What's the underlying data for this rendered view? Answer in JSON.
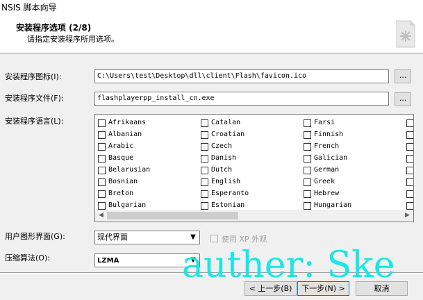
{
  "window": {
    "title": "NSIS 脚本向导"
  },
  "header": {
    "title": "安装程序选项 (2/8)",
    "subtitle": "请指定安装程序所用选项。",
    "icon": "setup-wizard-icon"
  },
  "fields": {
    "icon_label": "安装程序图标(I):",
    "icon_value": "C:\\Users\\test\\Desktop\\dll\\client\\Flash\\favicon.ico",
    "file_label": "安装程序文件(F):",
    "file_value": "flashplayerpp_install_cn.exe",
    "browse_label": "...",
    "language_label": "安装程序语言(L):"
  },
  "languages": [
    [
      "Afrikaans",
      "Albanian",
      "Arabic",
      "Basque",
      "Belarusian",
      "Bosnian",
      "Breton",
      "Bulgarian"
    ],
    [
      "Catalan",
      "Croatian",
      "Czech",
      "Danish",
      "Dutch",
      "English",
      "Esperanto",
      "Estonian"
    ],
    [
      "Farsi",
      "Finnish",
      "French",
      "Galician",
      "German",
      "Greek",
      "Hebrew",
      "Hungarian"
    ]
  ],
  "ui": {
    "label": "用户图形界面(G):",
    "value": "现代界面",
    "xp_label": "使用 XP 外观"
  },
  "compress": {
    "label": "压缩算法(O):",
    "value": "LZMA"
  },
  "watermark": "auther: Ske",
  "buttons": {
    "back": "< 上一步(B)",
    "next": "下一步(N) >",
    "cancel": "取消"
  },
  "colors": {
    "watermark": "#16e7e7",
    "default_button_border": "#0078d7"
  }
}
